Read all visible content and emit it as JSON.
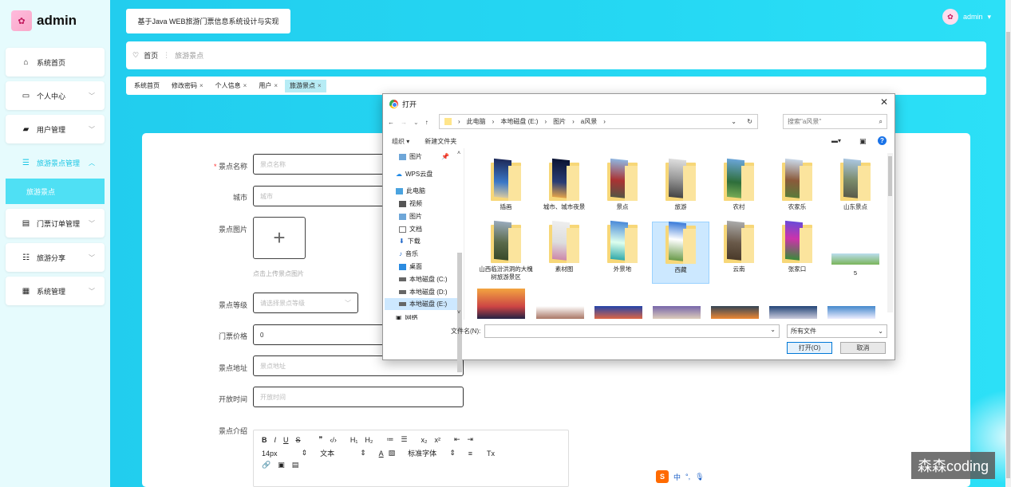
{
  "brand": {
    "name": "admin",
    "avatar_icon": "anime-avatar-icon"
  },
  "menu": {
    "items": [
      {
        "label": "系统首页",
        "icon": "home-icon"
      },
      {
        "label": "个人中心",
        "icon": "card-icon"
      },
      {
        "label": "用户管理",
        "icon": "users-icon"
      },
      {
        "label": "旅游景点管理",
        "icon": "list-icon"
      },
      {
        "label": "门票订单管理",
        "icon": "chat-icon"
      },
      {
        "label": "旅游分享",
        "icon": "sliders-icon"
      },
      {
        "label": "系统管理",
        "icon": "grid-icon"
      }
    ],
    "sub_item": "旅游景点"
  },
  "header": {
    "title": "基于Java WEB旅游门票信息系统设计与实现",
    "user": "admin"
  },
  "breadcrumb": {
    "home": "首页",
    "current": "旅游景点"
  },
  "tabs": [
    {
      "label": "系统首页"
    },
    {
      "label": "修改密码"
    },
    {
      "label": "个人信息"
    },
    {
      "label": "用户"
    },
    {
      "label": "旅游景点"
    }
  ],
  "form": {
    "name_label": "景点名称",
    "name_placeholder": "景点名称",
    "city_label": "城市",
    "city_placeholder": "城市",
    "image_label": "景点图片",
    "upload_hint": "点击上传景点图片",
    "level_label": "景点等级",
    "level_placeholder": "请选择景点等级",
    "price_label": "门票价格",
    "price_value": "0",
    "address_label": "景点地址",
    "address_placeholder": "景点地址",
    "open_label": "开放时间",
    "open_placeholder": "开放时间",
    "intro_label": "景点介绍",
    "editor": {
      "font_size": "14px",
      "block": "文本",
      "font": "标准字体"
    }
  },
  "dialog": {
    "title": "打开",
    "path": [
      "此电脑",
      "本地磁盘 (E:)",
      "图片",
      "a风景"
    ],
    "search_placeholder": "搜索\"a风景\"",
    "toolbar": {
      "organize": "组织",
      "new_folder": "新建文件夹"
    },
    "tree": [
      "图片",
      "WPS云盘",
      "此电脑",
      "视频",
      "图片",
      "文档",
      "下载",
      "音乐",
      "桌面",
      "本地磁盘 (C:)",
      "本地磁盘 (D:)",
      "本地磁盘 (E:)",
      "网络"
    ],
    "folders_row1": [
      "插画",
      "城市、城市夜景",
      "景点",
      "旅游",
      "农村",
      "农家乐",
      "山东景点"
    ],
    "folders_row2": [
      "山西临汾洪洞的大槐树旅游景区",
      "素材图",
      "外景地",
      "西藏",
      "云南",
      "张家口",
      "5"
    ],
    "filename_label": "文件名(N):",
    "filetype": "所有文件",
    "open_button": "打开(O)",
    "cancel_button": "取消"
  },
  "watermark": "森森coding",
  "ime": {
    "label": "中"
  }
}
